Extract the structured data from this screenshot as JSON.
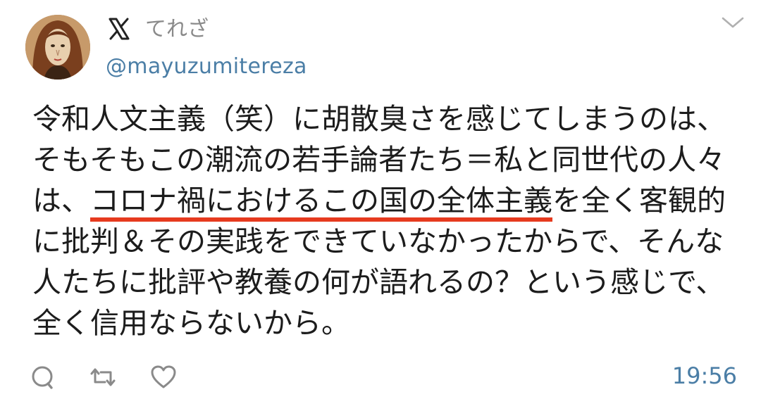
{
  "tweet": {
    "author_name": "てれざ",
    "author_handle": "@mayuzumitereza",
    "lines": [
      "令和人文主義（笑）に胡散臭さを感じてしまうのは、",
      "そもそもこの潮流の若手論者たち＝私と同世代の人々",
      "は、",
      "コロナ禍におけるこの国の全体主義",
      "を全く客観的",
      "に批判＆その実践をできていなかったからで、そんな",
      "人たちに批評や教養の何が語れるの？という感じで、",
      "全く信用ならないから。"
    ],
    "timestamp": "19:56"
  },
  "icons": {
    "platform": "x-logo-icon",
    "menu": "chevron-down-icon",
    "reply": "reply-icon",
    "retweet": "retweet-icon",
    "like": "heart-icon"
  },
  "colors": {
    "underline": "#e63a1e",
    "link_blue": "#4b7ea6",
    "muted": "#8a8a8a"
  }
}
